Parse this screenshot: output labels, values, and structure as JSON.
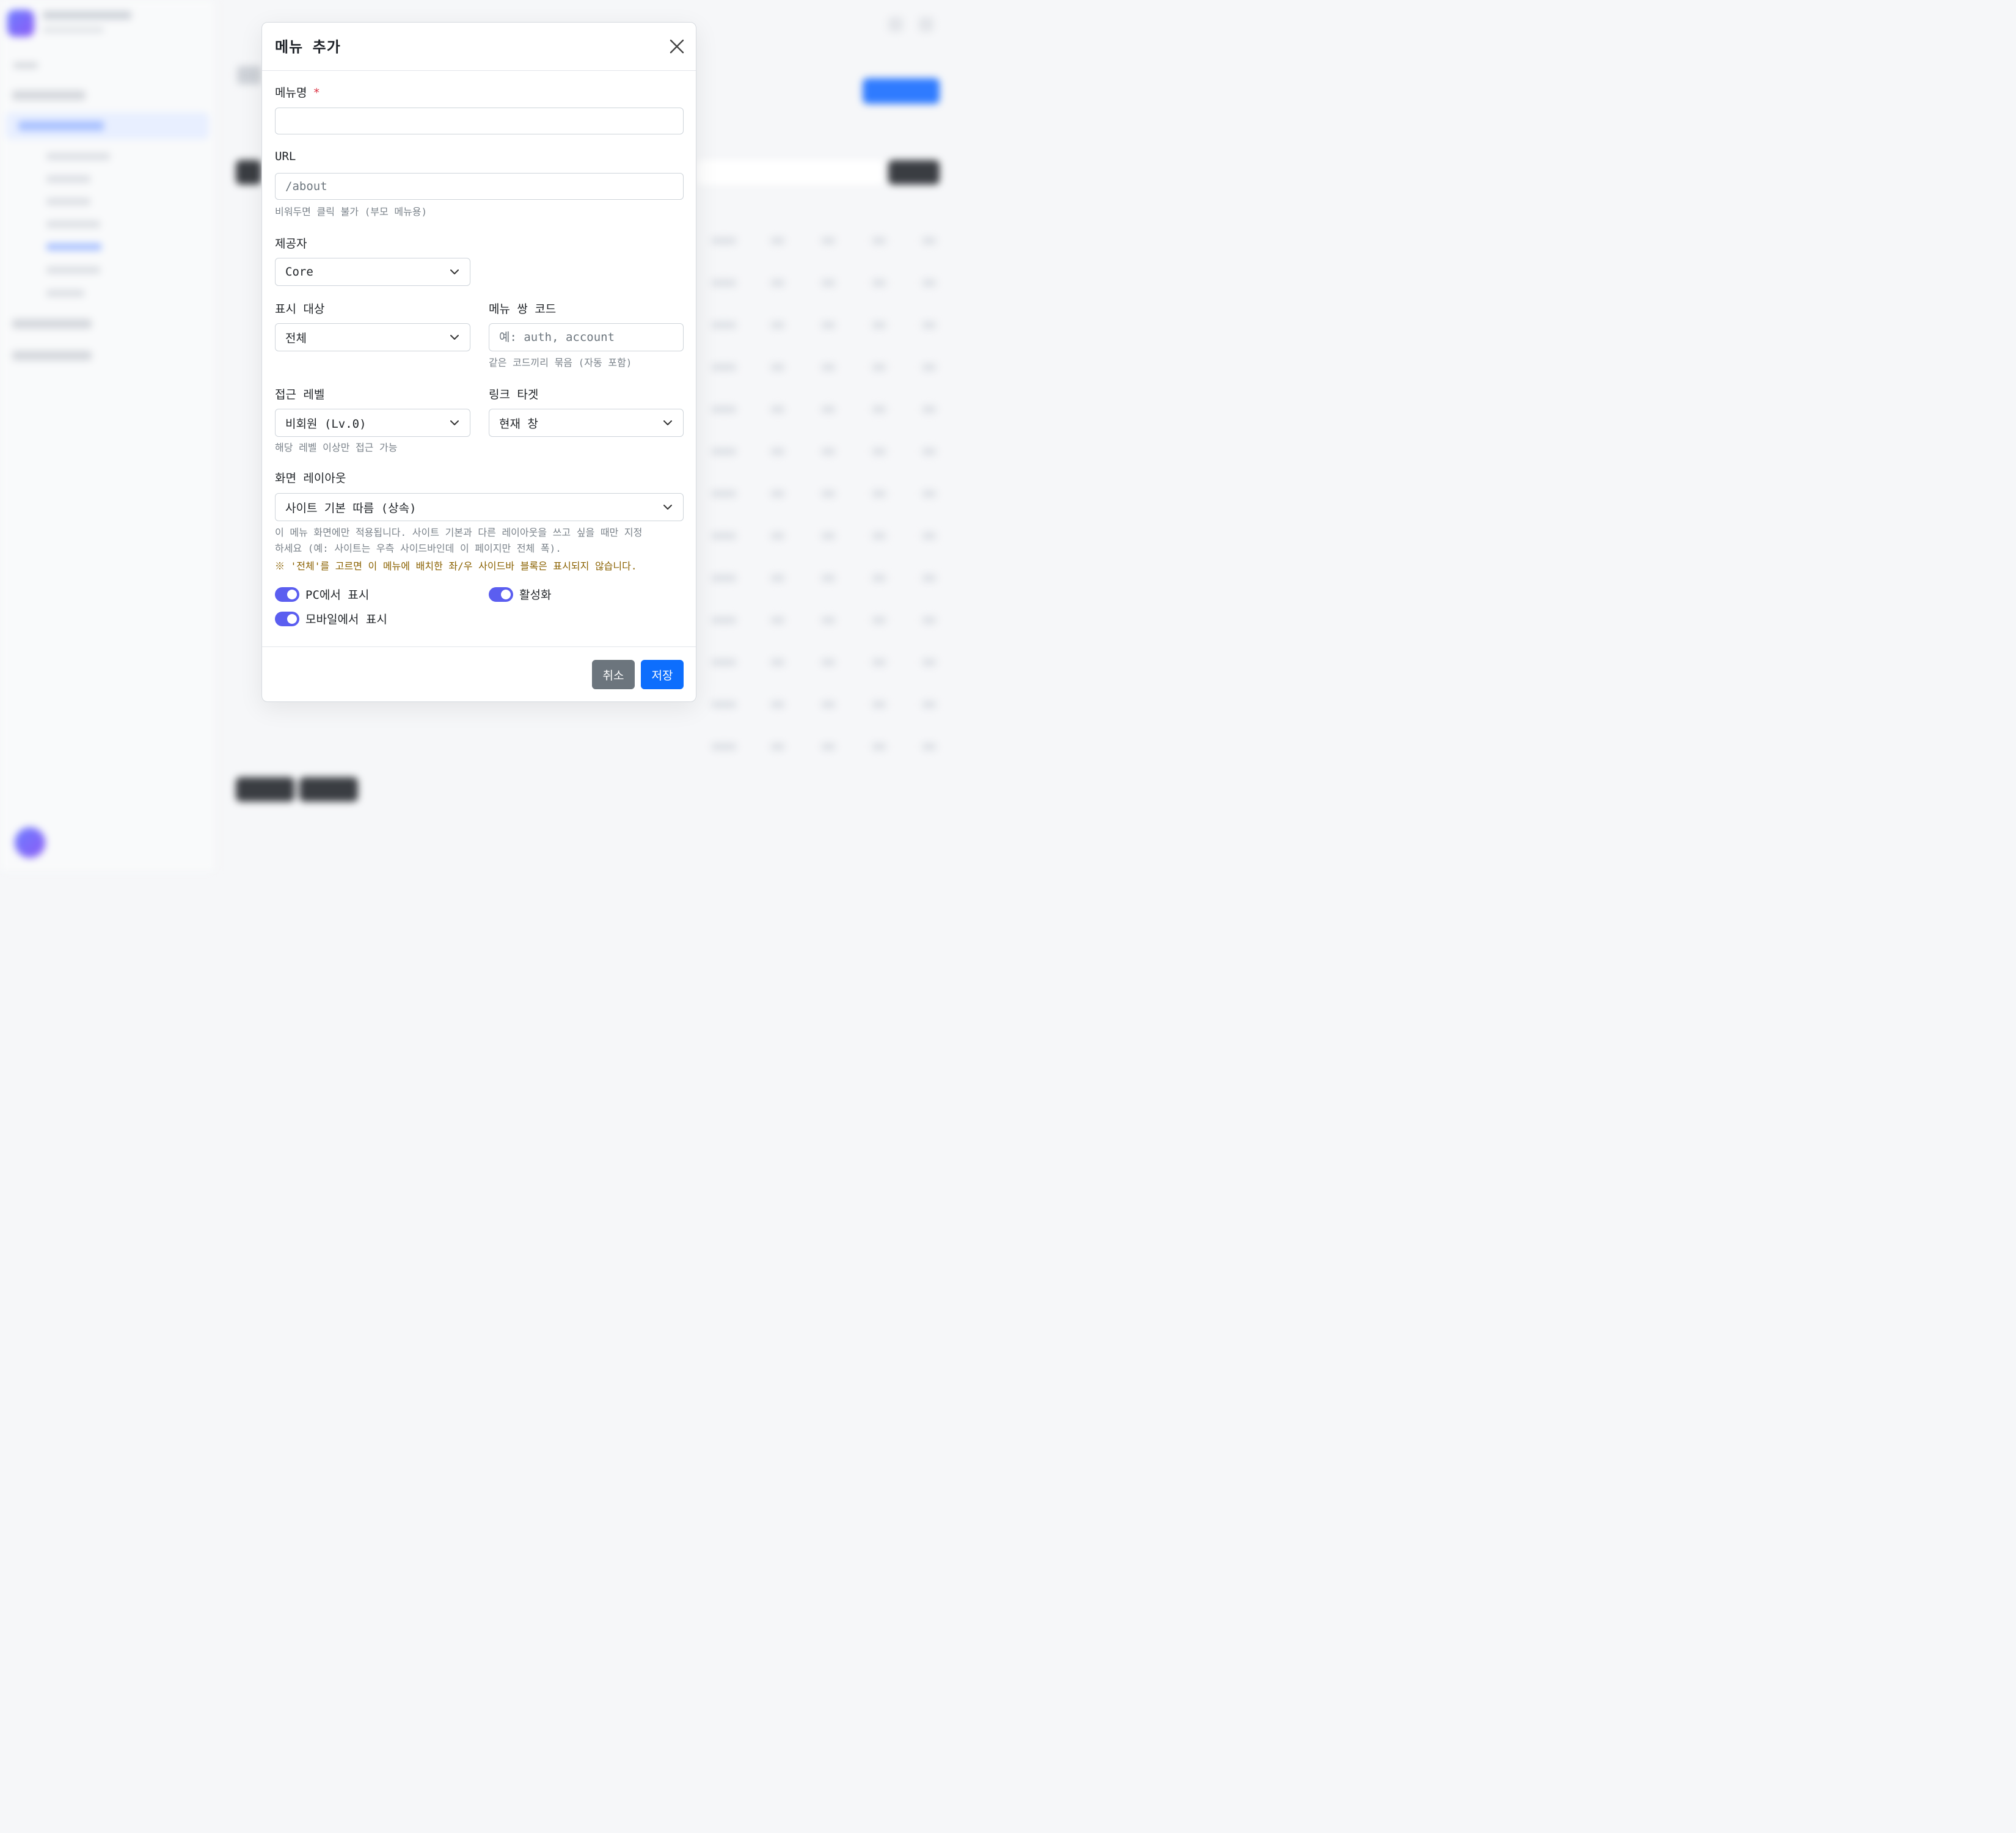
{
  "modal": {
    "title": "메뉴 추가",
    "fields": {
      "menu_name": {
        "label": "메뉴명",
        "required_mark": "*",
        "value": ""
      },
      "url": {
        "label": "URL",
        "placeholder": "/about",
        "help": "비워두면 클릭 불가 (부모 메뉴용)"
      },
      "provider": {
        "label": "제공자",
        "value": "Core"
      },
      "display_target": {
        "label": "표시 대상",
        "value": "전체"
      },
      "menu_pair_code": {
        "label": "메뉴 쌍 코드",
        "placeholder": "예: auth, account",
        "help": "같은 코드끼리 묶음 (자동 포함)"
      },
      "access_level": {
        "label": "접근 레벨",
        "value": "비회원 (Lv.0)",
        "help": "해당 레벨 이상만 접근 가능"
      },
      "link_target": {
        "label": "링크 타겟",
        "value": "현재 창"
      },
      "layout": {
        "label": "화면 레이아웃",
        "value": "사이트 기본 따름 (상속)",
        "help_line1": "이 메뉴 화면에만 적용됩니다. 사이트 기본과 다른 레이아웃을 쓰고 싶을 때만 지정",
        "help_line2": "하세요 (예: 사이트는 우측 사이드바인데 이 페이지만 전체 폭).",
        "warning": "※ '전체'를 고르면 이 메뉴에 배치한 좌/우 사이드바 블록은 표시되지 않습니다."
      }
    },
    "toggles": {
      "show_pc": {
        "label": "PC에서 표시",
        "on": true
      },
      "active": {
        "label": "활성화",
        "on": true
      },
      "show_mobile": {
        "label": "모바일에서 표시",
        "on": true
      }
    },
    "buttons": {
      "cancel": "취소",
      "save": "저장"
    }
  },
  "colors": {
    "primary": "#0d6efd",
    "toggle_on": "#5b5ef0",
    "cancel": "#6c757d",
    "required": "#dc3545",
    "warning": "#8a6100"
  },
  "icons": {
    "close": "close-icon",
    "chevron": "chevron-down-icon"
  }
}
